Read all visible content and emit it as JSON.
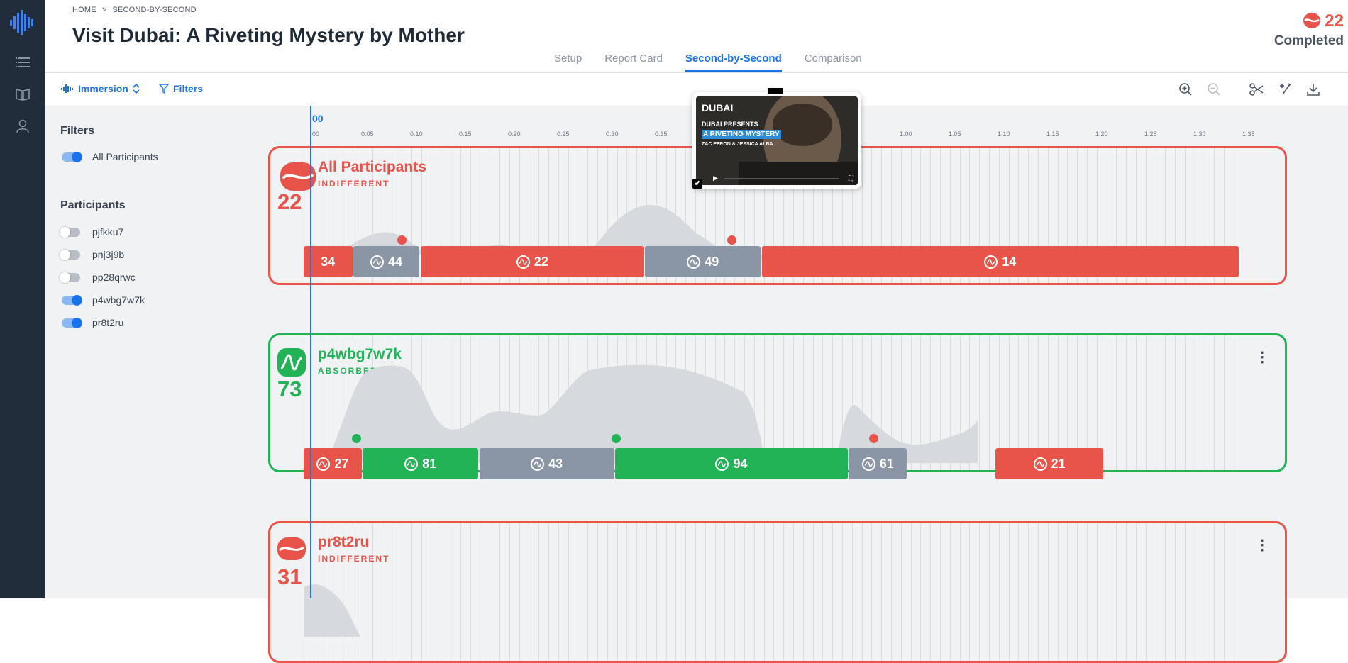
{
  "nav": {
    "icons": [
      "waveform-logo-icon",
      "list-icon",
      "book-icon",
      "person-icon"
    ]
  },
  "breadcrumb": {
    "home": "HOME",
    "separator": ">",
    "current": "SECOND-BY-SECOND"
  },
  "page_title": "Visit Dubai: A Riveting Mystery by Mother",
  "tabs": [
    {
      "label": "Setup",
      "active": false
    },
    {
      "label": "Report Card",
      "active": false
    },
    {
      "label": "Second-by-Second",
      "active": true
    },
    {
      "label": "Comparison",
      "active": false
    }
  ],
  "completed": {
    "count": "22",
    "label": "Completed"
  },
  "toolbar": {
    "immersion_label": "Immersion",
    "filters_label": "Filters"
  },
  "sidebar": {
    "filters_heading": "Filters",
    "all_participants_label": "All Participants",
    "all_participants_on": true,
    "participants_heading": "Participants",
    "participants": [
      {
        "id": "pjfkku7",
        "on": false
      },
      {
        "id": "pnj3j9b",
        "on": false
      },
      {
        "id": "pp28qrwc",
        "on": false
      },
      {
        "id": "p4wbg7w7k",
        "on": true
      },
      {
        "id": "pr8t2ru",
        "on": true
      }
    ]
  },
  "timeline": {
    "current_time": "00",
    "ticks": [
      "00",
      "0:05",
      "0:10",
      "0:15",
      "0:20",
      "0:25",
      "0:30",
      "0:35",
      "",
      "",
      "",
      "",
      "1:00",
      "1:05",
      "1:10",
      "1:15",
      "1:20",
      "1:25",
      "1:30",
      "1:35"
    ]
  },
  "video": {
    "brand": "DUBAI",
    "line1": "DUBAI PRESENTS",
    "line2": "A RIVETING MYSTERY",
    "line3": "ZAC EFRON & JESSICA ALBA"
  },
  "tracks": [
    {
      "name": "All Participants",
      "state": "INDIFFERENT",
      "score": "22",
      "color": "#e8534a",
      "segments": [
        {
          "value": "34",
          "kind": "red",
          "icon": false,
          "start": 0,
          "end": 0.052
        },
        {
          "value": "44",
          "kind": "gray",
          "icon": true,
          "start": 0.053,
          "end": 0.124
        },
        {
          "value": "22",
          "kind": "red",
          "icon": true,
          "start": 0.125,
          "end": 0.364
        },
        {
          "value": "49",
          "kind": "gray",
          "icon": true,
          "start": 0.365,
          "end": 0.489
        },
        {
          "value": "14",
          "kind": "red",
          "icon": true,
          "start": 0.49,
          "end": 1.0
        }
      ]
    },
    {
      "name": "p4wbg7w7k",
      "state": "ABSORBED",
      "score": "73",
      "color": "#22b357",
      "segments": [
        {
          "value": "27",
          "kind": "red",
          "icon": true,
          "start": 0,
          "end": 0.062
        },
        {
          "value": "81",
          "kind": "green",
          "icon": true,
          "start": 0.063,
          "end": 0.187
        },
        {
          "value": "43",
          "kind": "gray",
          "icon": true,
          "start": 0.188,
          "end": 0.332
        },
        {
          "value": "94",
          "kind": "green",
          "icon": true,
          "start": 0.333,
          "end": 0.582
        },
        {
          "value": "61",
          "kind": "gray",
          "icon": true,
          "start": 0.583,
          "end": 0.645
        },
        {
          "value": "21",
          "kind": "red",
          "icon": true,
          "start": 0.74,
          "end": 0.855
        }
      ]
    },
    {
      "name": "pr8t2ru",
      "state": "INDIFFERENT",
      "score": "31",
      "color": "#e8534a",
      "segments": []
    }
  ]
}
